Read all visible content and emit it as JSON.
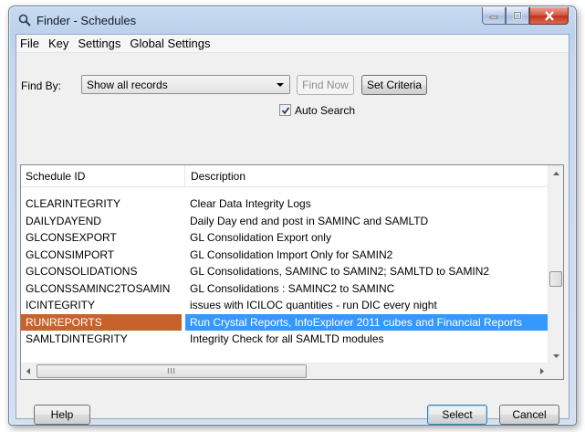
{
  "window": {
    "title": "Finder - Schedules",
    "icon": "magnifier-icon",
    "controls": [
      "minimize-icon",
      "maximize-icon",
      "close-icon"
    ]
  },
  "menu": [
    "File",
    "Key",
    "Settings",
    "Global Settings"
  ],
  "find": {
    "label": "Find By:",
    "selected": "Show all records",
    "find_now": "Find Now",
    "set_criteria": "Set Criteria",
    "auto_search_label": "Auto Search",
    "auto_search_checked": true
  },
  "grid": {
    "columns": [
      "Schedule ID",
      "Description"
    ],
    "rows": [
      {
        "id": "CLEARINTEGRITY",
        "desc": "Clear Data Integrity Logs"
      },
      {
        "id": "DAILYDAYEND",
        "desc": "Daily Day end and post in SAMINC and SAMLTD"
      },
      {
        "id": "GLCONSEXPORT",
        "desc": "GL Consolidation Export only"
      },
      {
        "id": "GLCONSIMPORT",
        "desc": "GL Consolidation Import Only for SAMIN2"
      },
      {
        "id": "GLCONSOLIDATIONS",
        "desc": "GL Consolidations, SAMINC to SAMIN2; SAMLTD to SAMIN2"
      },
      {
        "id": "GLCONSSAMINC2TOSAMIN",
        "desc": "GL Consolidations : SAMINC2 to SAMINC"
      },
      {
        "id": "ICINTEGRITY",
        "desc": "issues with ICILOC quantities - run DIC every night"
      },
      {
        "id": "RUNREPORTS",
        "desc": "Run Crystal Reports, InfoExplorer 2011 cubes and Financial Reports"
      },
      {
        "id": "SAMLTDINTEGRITY",
        "desc": "Integrity Check for all SAMLTD modules"
      }
    ],
    "selected_row": "RUNREPORTS",
    "scroll_grip": "III"
  },
  "buttons": {
    "help": "Help",
    "select": "Select",
    "cancel": "Cancel"
  },
  "colors": {
    "selected_id_bg": "#c8622a",
    "selected_desc_bg": "#3399ff"
  }
}
